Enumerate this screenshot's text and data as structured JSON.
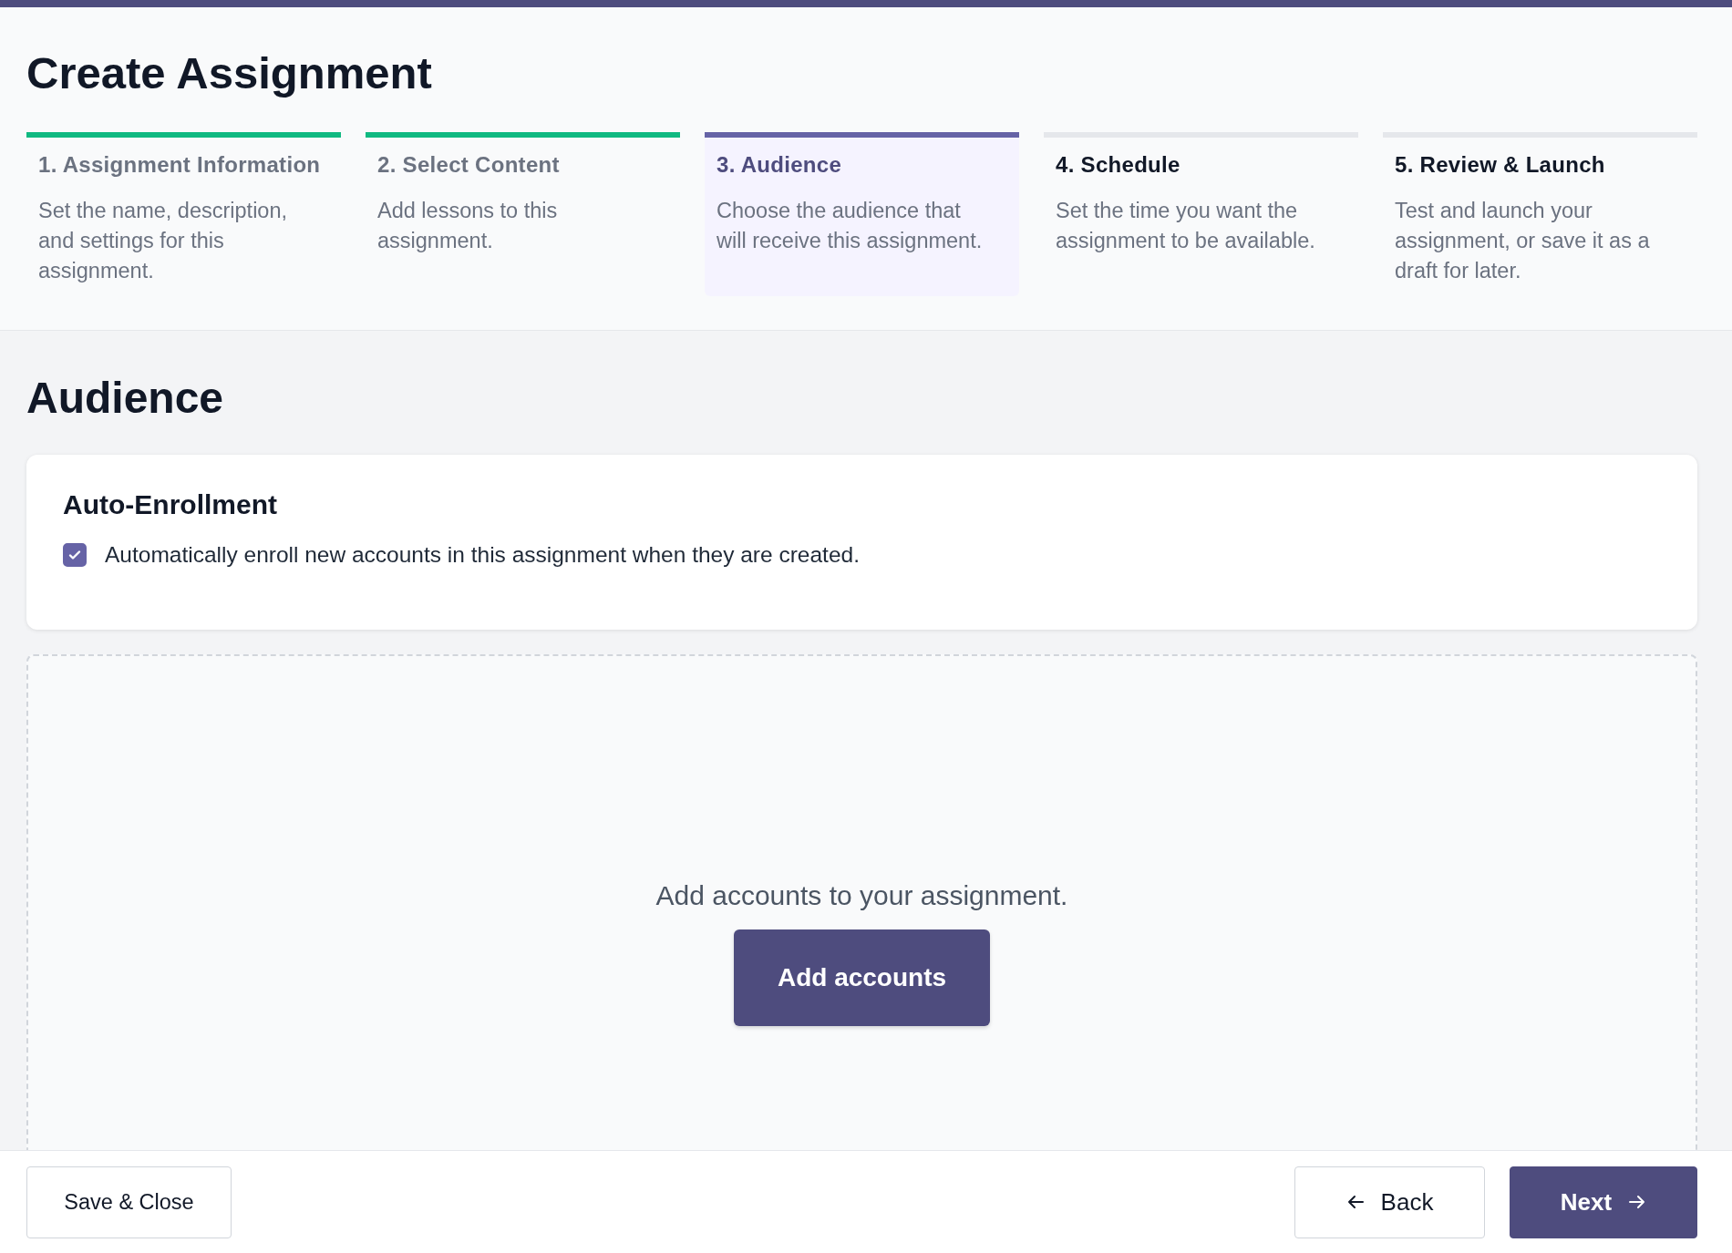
{
  "page": {
    "title": "Create Assignment"
  },
  "steps": [
    {
      "title": "1. Assignment Information",
      "description": "Set the name, description, and settings for this assignment.",
      "completed": true,
      "selected": false
    },
    {
      "title": "2. Select Content",
      "description": "Add lessons to this assignment.",
      "completed": true,
      "selected": false
    },
    {
      "title": "3. Audience",
      "description": "Choose the audience that will receive this assignment.",
      "completed": false,
      "selected": true
    },
    {
      "title": "4. Schedule",
      "description": "Set the time you want the assignment to be available.",
      "completed": false,
      "selected": false
    },
    {
      "title": "5. Review & Launch",
      "description": "Test and launch your assignment, or save it as a draft for later.",
      "completed": false,
      "selected": false
    }
  ],
  "section": {
    "title": "Audience"
  },
  "auto_enrollment": {
    "title": "Auto-Enrollment",
    "checkbox": {
      "label": "Automatically enroll new accounts in this assignment when they are created.",
      "checked": true
    }
  },
  "accounts": {
    "message": "Add accounts to your assignment.",
    "button": "Add accounts"
  },
  "footer": {
    "save_button": "Save & Close",
    "back_button": "Back",
    "next_button": "Next"
  }
}
